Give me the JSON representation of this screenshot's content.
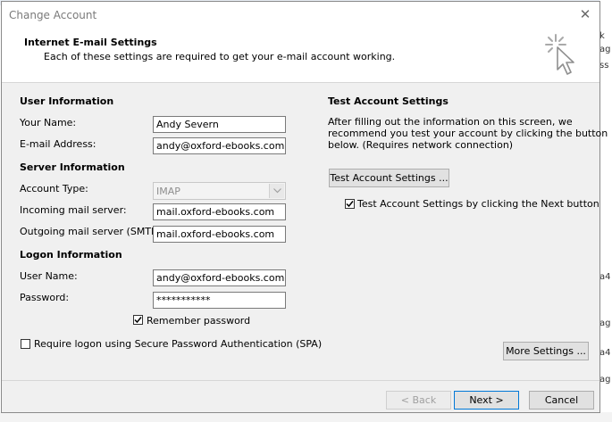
{
  "dialog": {
    "title": "Change Account",
    "header_title": "Internet E-mail Settings",
    "header_subtitle": "Each of these settings are required to get your e-mail account working."
  },
  "user_info": {
    "section": "User Information",
    "your_name_label": "Your Name:",
    "your_name_value": "Andy Severn",
    "email_label": "E-mail Address:",
    "email_value": "andy@oxford-ebooks.com"
  },
  "server_info": {
    "section": "Server Information",
    "account_type_label": "Account Type:",
    "account_type_value": "IMAP",
    "incoming_label": "Incoming mail server:",
    "incoming_value": "mail.oxford-ebooks.com",
    "outgoing_label": "Outgoing mail server (SMTP):",
    "outgoing_value": "mail.oxford-ebooks.com"
  },
  "logon_info": {
    "section": "Logon Information",
    "username_label": "User Name:",
    "username_value": "andy@oxford-ebooks.com",
    "password_label": "Password:",
    "password_value": "***********",
    "remember_label": "Remember password",
    "remember_checked": true,
    "spa_label": "Require logon using Secure Password Authentication (SPA)",
    "spa_checked": false
  },
  "test_settings": {
    "section": "Test Account Settings",
    "description_line1": "After filling out the information on this screen, we",
    "description_line2": "recommend you test your account by clicking the button",
    "description_line3": "below. (Requires network connection)",
    "test_button": "Test Account Settings ...",
    "auto_test_label": "Test Account Settings by clicking the Next button",
    "auto_test_checked": true
  },
  "buttons": {
    "more_settings": "More Settings ...",
    "back": "< Back",
    "next": "Next >",
    "cancel": "Cancel"
  },
  "background_fragments": [
    "k",
    "ag",
    "ss",
    "a4",
    "ag",
    "a4",
    "ag"
  ],
  "icons": {
    "close": "close-icon",
    "wizard": "wizard-cursor-icon",
    "dropdown": "chevron-down-icon",
    "check": "check-icon"
  },
  "colors": {
    "dialog_bg": "#f0f0f0",
    "focus_border": "#0078d7",
    "disabled_text": "#a0a0a0"
  }
}
